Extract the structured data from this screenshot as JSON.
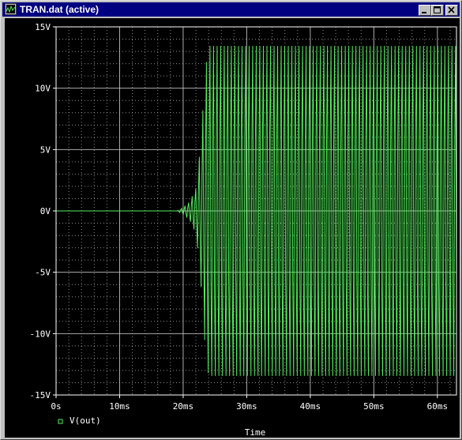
{
  "window": {
    "title": "TRAN.dat (active)"
  },
  "title_buttons": {
    "minimize": "minimize-icon",
    "maximize": "maximize-icon",
    "close": "close-icon"
  },
  "colors": {
    "trace": "#52f05a",
    "grid": "#c8c8c8",
    "axis": "#ffffff",
    "background": "#000000",
    "titlebar": "#000080"
  },
  "chart_data": {
    "type": "line",
    "xlabel": "Time",
    "ylabel": "",
    "xlim": [
      0,
      63
    ],
    "x_unit": "ms",
    "ylim": [
      -15,
      15
    ],
    "y_unit": "V",
    "grid": true,
    "x_ticks": [
      {
        "value": 0,
        "label": "0s"
      },
      {
        "value": 10,
        "label": "10ms"
      },
      {
        "value": 20,
        "label": "20ms"
      },
      {
        "value": 30,
        "label": "30ms"
      },
      {
        "value": 40,
        "label": "40ms"
      },
      {
        "value": 50,
        "label": "50ms"
      },
      {
        "value": 60,
        "label": "60ms"
      }
    ],
    "y_ticks": [
      {
        "value": 15,
        "label": "15V"
      },
      {
        "value": 10,
        "label": "10V"
      },
      {
        "value": 5,
        "label": "5V"
      },
      {
        "value": 0,
        "label": "0V"
      },
      {
        "value": -5,
        "label": "-5V"
      },
      {
        "value": -10,
        "label": "-10V"
      },
      {
        "value": -15,
        "label": "-15V"
      }
    ],
    "series": [
      {
        "name": "V(out)",
        "color": "#52f05a",
        "marker": "square",
        "envelope": {
          "x": [
            0,
            19.0,
            20.0,
            21.0,
            22.0,
            22.5,
            23.0,
            23.5,
            24.0,
            63.0
          ],
          "amplitude": [
            0,
            0,
            0.3,
            0.8,
            2.0,
            4.5,
            8.0,
            12.5,
            14.6,
            14.6
          ]
        },
        "oscillation_period_ms": 0.56
      }
    ]
  }
}
